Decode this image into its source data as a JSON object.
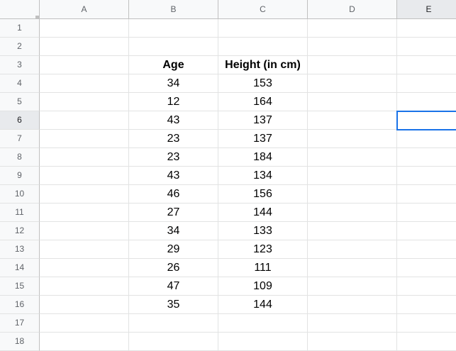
{
  "columns": [
    "A",
    "B",
    "C",
    "D",
    "E"
  ],
  "rows": [
    "1",
    "2",
    "3",
    "4",
    "5",
    "6",
    "7",
    "8",
    "9",
    "10",
    "11",
    "12",
    "13",
    "14",
    "15",
    "16",
    "17",
    "18"
  ],
  "selected": {
    "column": "E",
    "row": "6"
  },
  "colors": {
    "selection": "#1a73e8",
    "header_bg": "#f8f9fa",
    "header_selected_bg": "#e8eaed"
  },
  "table": {
    "headers": [
      "Age",
      "Height (in cm)"
    ],
    "rows": [
      [
        "34",
        "153"
      ],
      [
        "12",
        "164"
      ],
      [
        "43",
        "137"
      ],
      [
        "23",
        "137"
      ],
      [
        "23",
        "184"
      ],
      [
        "43",
        "134"
      ],
      [
        "46",
        "156"
      ],
      [
        "27",
        "144"
      ],
      [
        "34",
        "133"
      ],
      [
        "29",
        "123"
      ],
      [
        "26",
        "111"
      ],
      [
        "47",
        "109"
      ],
      [
        "35",
        "144"
      ]
    ]
  }
}
